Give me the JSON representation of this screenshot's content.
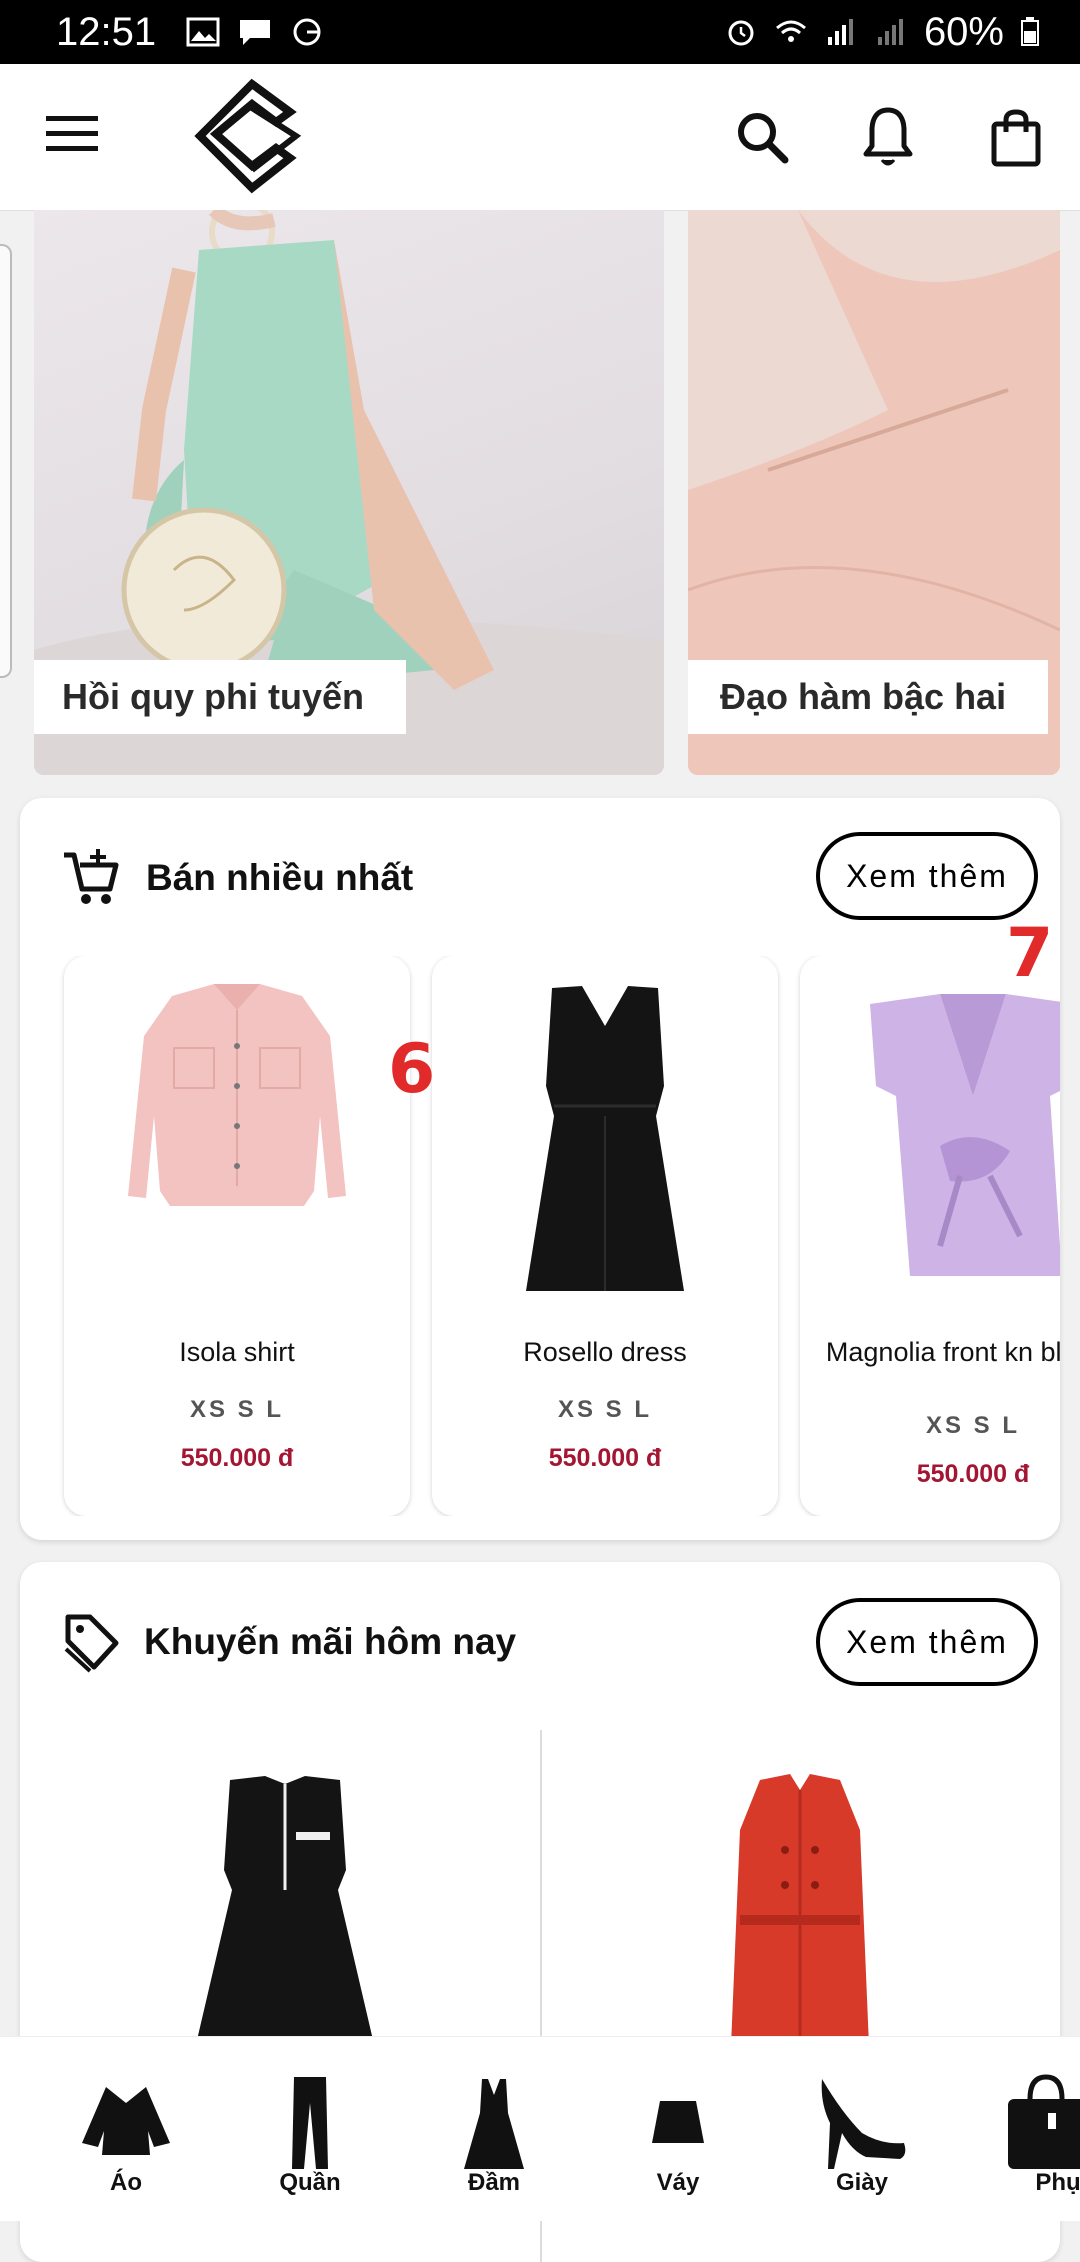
{
  "status_bar": {
    "time": "12:51",
    "battery": "60%"
  },
  "banners": [
    {
      "label": "Hồi quy phi tuyến"
    },
    {
      "label": "Đạo hàm bậc hai"
    }
  ],
  "best_sellers": {
    "title": "Bán nhiều nhất",
    "more_label": "Xem thêm",
    "products": [
      {
        "name": "Isola shirt",
        "sizes": "XS S L",
        "price": "550.000 đ"
      },
      {
        "name": "Rosello dress",
        "sizes": "XS S L",
        "price": "550.000 đ"
      },
      {
        "name": "Magnolia front kn blouse",
        "sizes": "XS S L",
        "price": "550.000 đ"
      }
    ],
    "annotations": [
      "6",
      "7"
    ]
  },
  "promotions": {
    "title": "Khuyến mãi hôm nay",
    "more_label": "Xem thêm"
  },
  "bottom_nav": [
    {
      "label": "Áo",
      "icon": "top-icon"
    },
    {
      "label": "Quần",
      "icon": "pants-icon"
    },
    {
      "label": "Đầm",
      "icon": "dress-icon"
    },
    {
      "label": "Váy",
      "icon": "skirt-icon"
    },
    {
      "label": "Giày",
      "icon": "heel-icon"
    },
    {
      "label": "Phụ kiệ",
      "icon": "handbag-icon"
    }
  ],
  "colors": {
    "price": "#a31531",
    "annotation": "#e12b2b",
    "accent": "#000000"
  }
}
